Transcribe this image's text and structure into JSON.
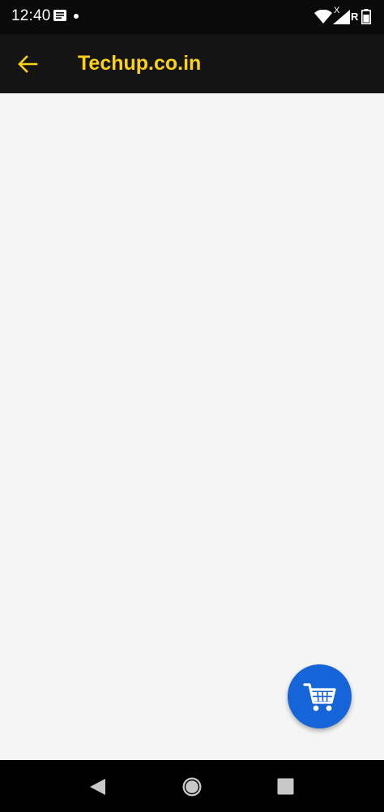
{
  "status_bar": {
    "time": "12:40",
    "network_x": "X",
    "roaming": "R"
  },
  "app_bar": {
    "title": "Techup.co.in"
  },
  "colors": {
    "title": "#fcd116",
    "back_arrow": "#fcd116",
    "fab": "#1565d8",
    "toolbar": "#141414",
    "background": "#f5f5f5"
  },
  "icons": {
    "back": "arrow-back-icon",
    "fab": "shopping-cart-icon",
    "nav_back": "triangle-back-icon",
    "nav_home": "circle-home-icon",
    "nav_recents": "square-recents-icon"
  }
}
